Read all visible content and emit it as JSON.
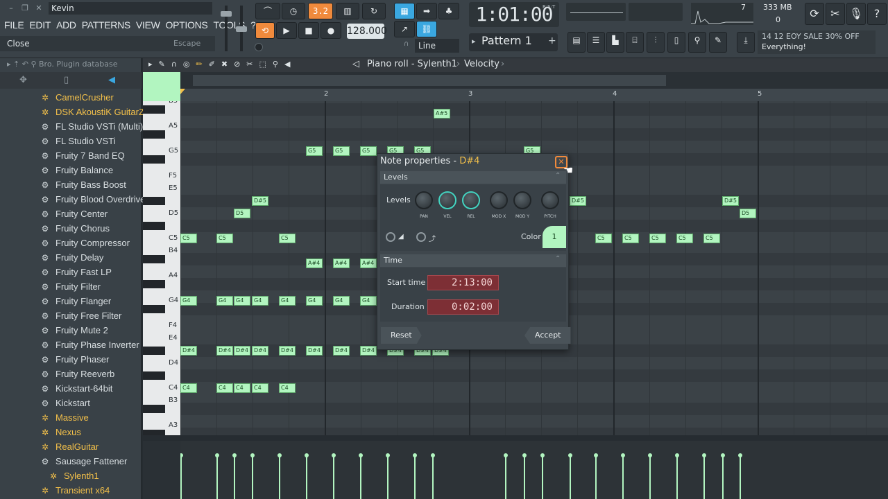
{
  "window": {
    "user": "Kevin"
  },
  "menu": [
    "FILE",
    "EDIT",
    "ADD",
    "PATTERNS",
    "VIEW",
    "OPTIONS",
    "TOOLS",
    "?"
  ],
  "hint": {
    "left": "Close",
    "right": "Escape"
  },
  "transport": {
    "time": "1:01:00",
    "time_unit": "B:S:T",
    "tempo": "128.000",
    "snap": "Line",
    "pattern": "Pattern 1",
    "counter": "3.2"
  },
  "monitor": {
    "cpu": "7",
    "memory": "333 MB",
    "polyphony": "0"
  },
  "news": {
    "line1": "14 12  EOY SALE 30% OFF",
    "line2": "Everything!"
  },
  "browser": {
    "header": "Bro.  Plugin database",
    "items": [
      {
        "label": "CamelCrusher",
        "gen": true
      },
      {
        "label": "DSK AkoustiK GuitarZ",
        "gen": true
      },
      {
        "label": "FL Studio VSTi (Multi)",
        "gen": false
      },
      {
        "label": "FL Studio VSTi",
        "gen": false
      },
      {
        "label": "Fruity 7 Band EQ",
        "gen": false
      },
      {
        "label": "Fruity Balance",
        "gen": false
      },
      {
        "label": "Fruity Bass Boost",
        "gen": false
      },
      {
        "label": "Fruity Blood Overdrive",
        "gen": false
      },
      {
        "label": "Fruity Center",
        "gen": false
      },
      {
        "label": "Fruity Chorus",
        "gen": false
      },
      {
        "label": "Fruity Compressor",
        "gen": false
      },
      {
        "label": "Fruity Delay",
        "gen": false
      },
      {
        "label": "Fruity Fast LP",
        "gen": false
      },
      {
        "label": "Fruity Filter",
        "gen": false
      },
      {
        "label": "Fruity Flanger",
        "gen": false
      },
      {
        "label": "Fruity Free Filter",
        "gen": false
      },
      {
        "label": "Fruity Mute 2",
        "gen": false
      },
      {
        "label": "Fruity Phase Inverter",
        "gen": false
      },
      {
        "label": "Fruity Phaser",
        "gen": false
      },
      {
        "label": "Fruity Reeverb",
        "gen": false
      },
      {
        "label": "Kickstart-64bit",
        "gen": false
      },
      {
        "label": "Kickstart",
        "gen": false
      },
      {
        "label": "Massive",
        "gen": true
      },
      {
        "label": "Nexus",
        "gen": true
      },
      {
        "label": "RealGuitar",
        "gen": true
      },
      {
        "label": "Sausage Fattener",
        "gen": false
      },
      {
        "label": "Sylenth1",
        "gen": true
      },
      {
        "label": "Transient x64",
        "gen": true
      }
    ]
  },
  "pianoroll": {
    "title": "Piano roll - Sylenth1",
    "target": "Velocity",
    "bars": [
      "2",
      "3",
      "4",
      "5"
    ],
    "key_labels": [
      "B5",
      "A5",
      "G5",
      "F5",
      "E5",
      "D5",
      "C5",
      "B4",
      "A4",
      "G4",
      "F4",
      "E4",
      "D4",
      "C4",
      "B3",
      "A3"
    ]
  },
  "dialog": {
    "title": "Note properties - ",
    "note": "D#4",
    "levels_section": "Levels",
    "levels_label": "Levels",
    "knobs": [
      "PAN",
      "VEL",
      "REL",
      "MOD X",
      "MOD Y",
      "PITCH"
    ],
    "color_label": "Color",
    "color_value": "1",
    "time_section": "Time",
    "start_label": "Start time",
    "start_value": "2:13:00",
    "duration_label": "Duration",
    "duration_value": "0:02:00",
    "reset": "Reset",
    "accept": "Accept"
  }
}
